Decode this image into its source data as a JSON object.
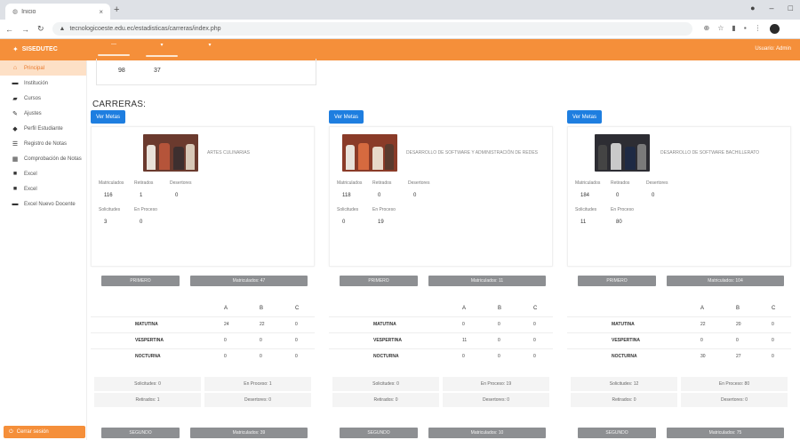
{
  "browser": {
    "tab_title": "Inicio",
    "url": "tecnologicoeste.edu.ec/estadisticas/carreras/index.php"
  },
  "app": {
    "brand": "SISEDUTEC",
    "menu": [
      "—",
      "▾",
      "▾"
    ],
    "user": "Usuario: Admin"
  },
  "sidebar": {
    "items": [
      {
        "label": "Principal",
        "icon": "home-icon",
        "active": true
      },
      {
        "label": "Institución",
        "icon": "card-icon"
      },
      {
        "label": "Cursos",
        "icon": "folder-icon"
      },
      {
        "label": "Ajustes",
        "icon": "wrench-icon"
      },
      {
        "label": "Perfil Estudiante",
        "icon": "user-icon"
      },
      {
        "label": "Registro de Notas",
        "icon": "list-icon"
      },
      {
        "label": "Comprobación de Notas",
        "icon": "grid-icon"
      },
      {
        "label": "Excel",
        "icon": "file-icon"
      },
      {
        "label": "Excel",
        "icon": "file-icon"
      },
      {
        "label": "Excel Nuevo Docente",
        "icon": "card-icon"
      }
    ],
    "footer": "Cerrar sesión"
  },
  "summary": {
    "values": [
      "98",
      "37"
    ]
  },
  "main": {
    "section_title": "CARRERAS:",
    "careers": [
      {
        "ver_metas": "Ver Metas",
        "name": "ARTES CULINARIAS",
        "stats_labels": [
          "Matriculados",
          "Retirados",
          "Desertores"
        ],
        "stats_values": [
          "116",
          "1",
          "0"
        ],
        "stats2_labels": [
          "Solicitudes",
          "En Proceso"
        ],
        "stats2_values": [
          "3",
          "0"
        ],
        "btn_left": "PRIMERO",
        "btn_right": "Matriculados: 47",
        "headers": [
          "A",
          "B",
          "C"
        ],
        "turnos": [
          {
            "name": "MATUTINA",
            "a": "24",
            "b": "22",
            "c": "0"
          },
          {
            "name": "VESPERTINA",
            "a": "0",
            "b": "0",
            "c": "0"
          },
          {
            "name": "NOCTURNA",
            "a": "0",
            "b": "0",
            "c": "0"
          }
        ],
        "sum": [
          "Solicitudes: 0",
          "En Proceso: 1",
          "Retirados: 1",
          "Desertores: 0"
        ],
        "btn2_left": "SEGUNDO",
        "btn2_right": "Matriculados: 39"
      },
      {
        "ver_metas": "Ver Metas",
        "name": "DESARROLLO DE SOFTWARE Y ADMINISTRACIÓN DE REDES",
        "stats_labels": [
          "Matriculados",
          "Retirados",
          "Desertores"
        ],
        "stats_values": [
          "118",
          "0",
          "0"
        ],
        "stats2_labels": [
          "Solicitudes",
          "En Proceso"
        ],
        "stats2_values": [
          "0",
          "19"
        ],
        "btn_left": "PRIMERO",
        "btn_right": "Matriculados: 11",
        "headers": [
          "A",
          "B",
          "C"
        ],
        "turnos": [
          {
            "name": "MATUTINA",
            "a": "0",
            "b": "0",
            "c": "0"
          },
          {
            "name": "VESPERTINA",
            "a": "11",
            "b": "0",
            "c": "0"
          },
          {
            "name": "NOCTURNA",
            "a": "0",
            "b": "0",
            "c": "0"
          }
        ],
        "sum": [
          "Solicitudes: 0",
          "En Proceso: 19",
          "Retirados: 0",
          "Desertores: 0"
        ],
        "btn2_left": "SEGUNDO",
        "btn2_right": "Matriculados: 10"
      },
      {
        "ver_metas": "Ver Metas",
        "name": "DESARROLLO DE SOFTWARE BACHILLERATO",
        "stats_labels": [
          "Matriculados",
          "Retirados",
          "Desertores"
        ],
        "stats_values": [
          "184",
          "0",
          "0"
        ],
        "stats2_labels": [
          "Solicitudes",
          "En Proceso"
        ],
        "stats2_values": [
          "11",
          "80"
        ],
        "btn_left": "PRIMERO",
        "btn_right": "Matriculados: 104",
        "headers": [
          "A",
          "B",
          "C"
        ],
        "turnos": [
          {
            "name": "MATUTINA",
            "a": "22",
            "b": "20",
            "c": "0"
          },
          {
            "name": "VESPERTINA",
            "a": "0",
            "b": "0",
            "c": "0"
          },
          {
            "name": "NOCTURNA",
            "a": "30",
            "b": "27",
            "c": "0"
          }
        ],
        "sum": [
          "Solicitudes: 12",
          "En Proceso: 80",
          "Retirados: 0",
          "Desertores: 0"
        ],
        "btn2_left": "SEGUNDO",
        "btn2_right": "Matriculados: 75"
      }
    ]
  }
}
